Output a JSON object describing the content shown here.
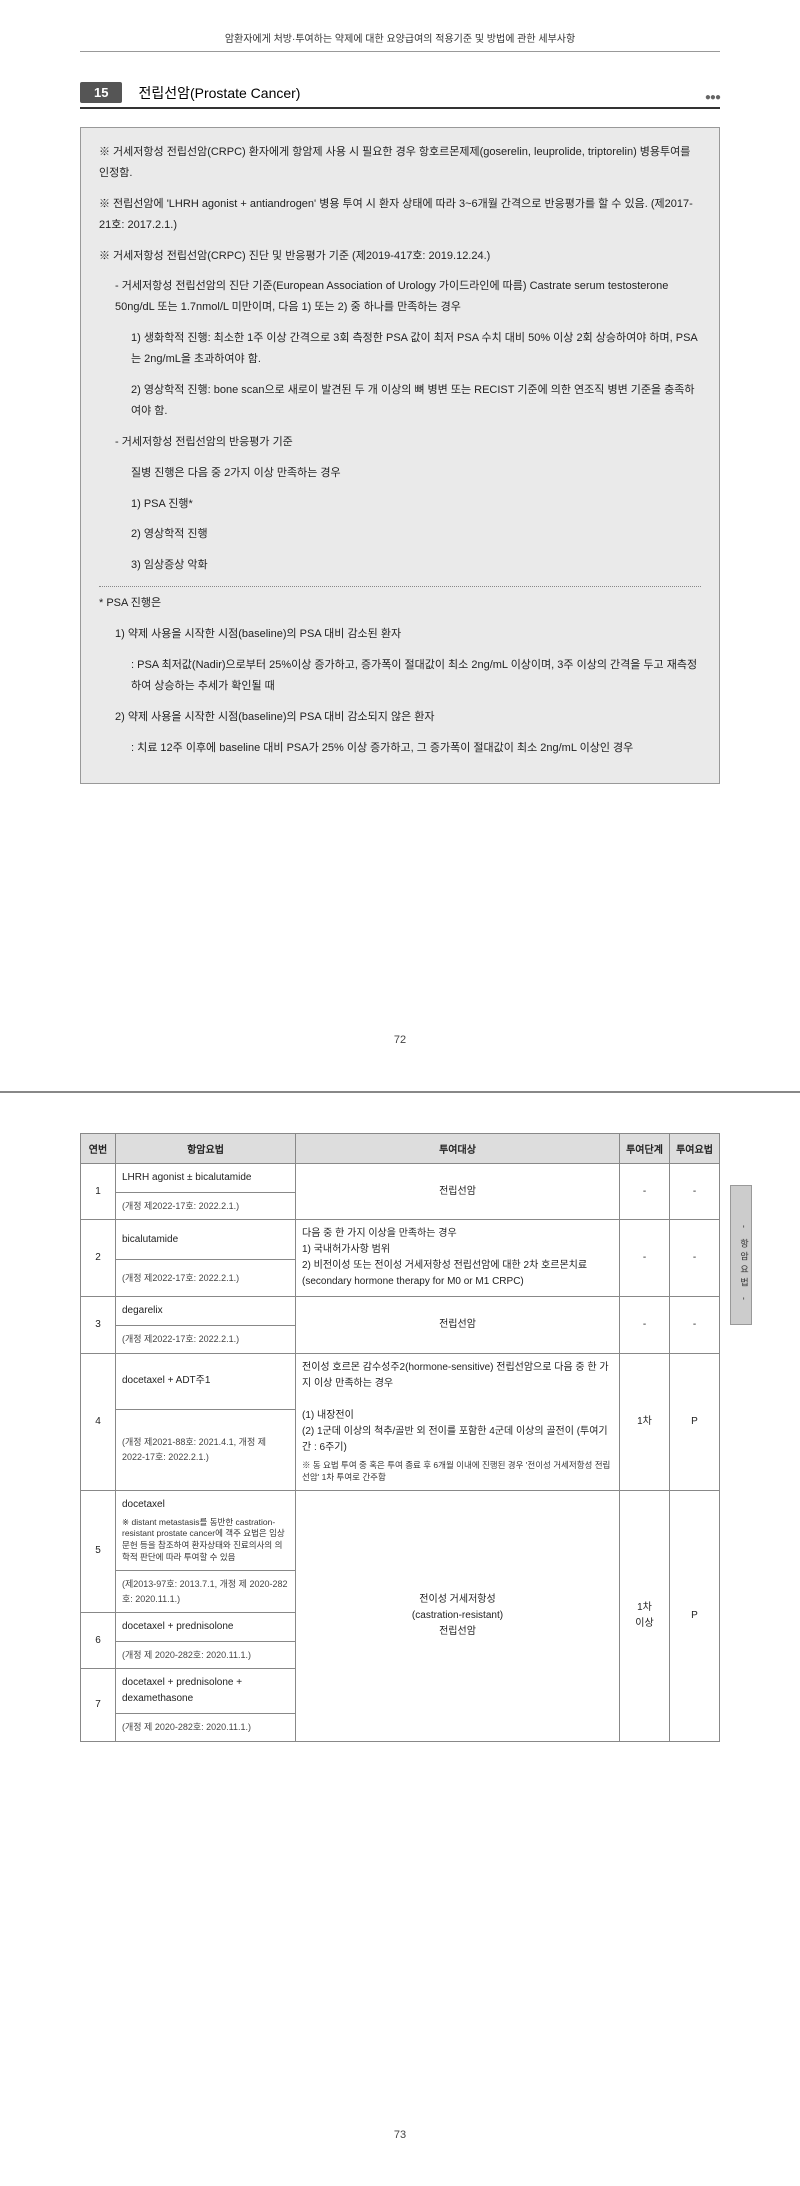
{
  "header": "암환자에게 처방·투여하는 약제에 대한 요양급여의 적용기준 및 방법에 관한 세부사항",
  "section": {
    "num": "15",
    "title": "전립선암(Prostate Cancer)"
  },
  "box": {
    "p1": "※ 거세저항성 전립선암(CRPC) 환자에게 항암제 사용 시 필요한 경우 항호르몬제제(goserelin, leuprolide, triptorelin) 병용투여를 인정함.",
    "p2": "※ 전립선암에 'LHRH agonist + antiandrogen' 병용 투여 시 환자 상태에 따라 3~6개월 간격으로 반응평가를 할 수 있음. (제2017-21호: 2017.2.1.)",
    "p3": "※ 거세저항성 전립선암(CRPC) 진단 및 반응평가 기준 (제2019-417호: 2019.12.24.)",
    "p3_1": "- 거세저항성 전립선암의 진단 기준(European Association of Urology 가이드라인에 따름) Castrate serum testosterone 50ng/dL 또는 1.7nmol/L 미만이며, 다음 1) 또는 2) 중 하나를 만족하는 경우",
    "p3_1_1": "1) 생화학적 진행: 최소한 1주 이상 간격으로 3회 측정한 PSA 값이 최저 PSA 수치 대비 50% 이상 2회 상승하여야 하며, PSA는 2ng/mL을 초과하여야 함.",
    "p3_1_2": "2) 영상학적 진행: bone scan으로 새로이 발견된 두 개 이상의 뼈 병변 또는 RECIST 기준에 의한 연조직 병변 기준을 충족하여야 함.",
    "p3_2": "- 거세저항성 전립선암의 반응평가 기준",
    "p3_2_a": "질병 진행은 다음 중 2가지 이상 만족하는 경우",
    "p3_2_1": "1) PSA 진행*",
    "p3_2_2": "2) 영상학적 진행",
    "p3_2_3": "3) 임상증상 악화",
    "psa_head": "* PSA 진행은",
    "psa_1": "1) 약제 사용을 시작한 시점(baseline)의 PSA 대비 감소된 환자",
    "psa_1_a": ": PSA 최저값(Nadir)으로부터 25%이상 증가하고, 증가폭이 절대값이 최소 2ng/mL 이상이며, 3주 이상의 간격을 두고 재측정하여 상승하는 추세가 확인될 때",
    "psa_2": "2) 약제 사용을 시작한 시점(baseline)의 PSA 대비 감소되지 않은 환자",
    "psa_2_a": ": 치료 12주 이후에 baseline 대비 PSA가 25% 이상 증가하고, 그 증가폭이 절대값이 최소 2ng/mL 이상인 경우"
  },
  "page1num": "72",
  "page2num": "73",
  "table": {
    "headers": {
      "c1": "연번",
      "c2": "항암요법",
      "c3": "투여대상",
      "c4": "투여단계",
      "c5": "투여요법"
    },
    "r1": {
      "num": "1",
      "drug": "LHRH agonist ± bicalutamide",
      "rev": "(개정 제2022-17호: 2022.2.1.)",
      "target": "전립선암",
      "stage": "-",
      "method": "-"
    },
    "r2": {
      "num": "2",
      "drug": "bicalutamide",
      "rev": "(개정 제2022-17호: 2022.2.1.)",
      "target": "다음 중 한 가지 이상을 만족하는 경우\n1) 국내허가사항 범위\n2) 비전이성 또는 전이성 거세저항성 전립선암에 대한 2차 호르몬치료 (secondary hormone therapy for M0 or M1 CRPC)",
      "stage": "-",
      "method": "-"
    },
    "r3": {
      "num": "3",
      "drug": "degarelix",
      "rev": "(개정 제2022-17호: 2022.2.1.)",
      "target": "전립선암",
      "stage": "-",
      "method": "-"
    },
    "r4": {
      "num": "4",
      "drug": "docetaxel + ADT주1",
      "rev": "(개정 제2021-88호: 2021.4.1, 개정 제2022-17호: 2022.2.1.)",
      "target": "전이성 호르몬 감수성주2(hormone-sensitive) 전립선암으로 다음 중 한 가지 이상 만족하는 경우\n\n(1) 내장전이\n(2) 1군데 이상의 척추/골반 외 전이를 포함한 4군데 이상의 골전이 (투여기간 : 6주기)",
      "target_note": "※ 동 요법 투여 중 혹은 투여 종료 후 6개월 이내에 진행된 경우 '전이성 거세저항성 전립선암' 1차 투여로 간주함",
      "stage": "1차",
      "method": "P"
    },
    "r5": {
      "num": "5",
      "drug": "docetaxel",
      "drug_note": "※ distant metastasis를 동반한 castration-resistant prostate cancer에 객주 요법은 임상문헌 등을 참조하여 환자상태와 진료의사의 의학적 판단에 따라 투여할 수 있음",
      "rev": "(제2013-97호: 2013.7.1, 개정 제 2020-282호: 2020.11.1.)",
      "target": "전이성 거세저항성\n(castration-resistant)\n전립선암",
      "stage": "1차\n이상",
      "method": "P"
    },
    "r6": {
      "num": "6",
      "drug": "docetaxel + prednisolone",
      "rev": "(개정 제 2020-282호: 2020.11.1.)"
    },
    "r7": {
      "num": "7",
      "drug": "docetaxel + prednisolone + dexamethasone",
      "rev": "(개정 제 2020-282호: 2020.11.1.)"
    }
  },
  "sidetab": "- 항암요법 -"
}
